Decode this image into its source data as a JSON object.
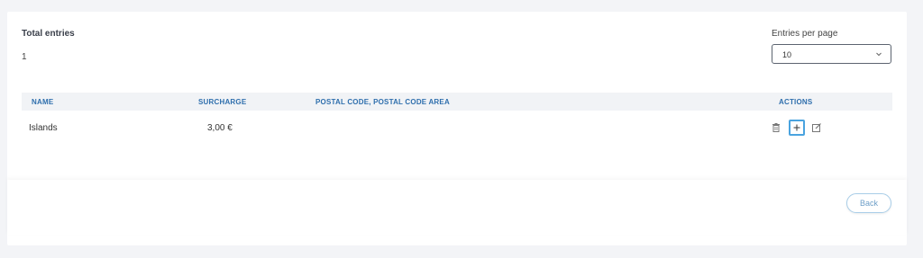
{
  "summary": {
    "total_label": "Total entries",
    "total_value": "1"
  },
  "pagination": {
    "entries_per_page_label": "Entries per page",
    "entries_per_page_value": "10"
  },
  "table": {
    "columns": [
      "NAME",
      "SURCHARGE",
      "POSTAL CODE, POSTAL CODE AREA",
      "ACTIONS"
    ],
    "rows": [
      {
        "name": "Islands",
        "surcharge": "3,00 €",
        "postal": ""
      }
    ],
    "row_actions": [
      "delete-icon",
      "add-icon",
      "edit-icon"
    ]
  },
  "footer": {
    "back_label": "Back"
  },
  "colors": {
    "header_text": "#2f6fad",
    "focus_outline": "#4aa3df",
    "back_border": "#a8cde8"
  }
}
